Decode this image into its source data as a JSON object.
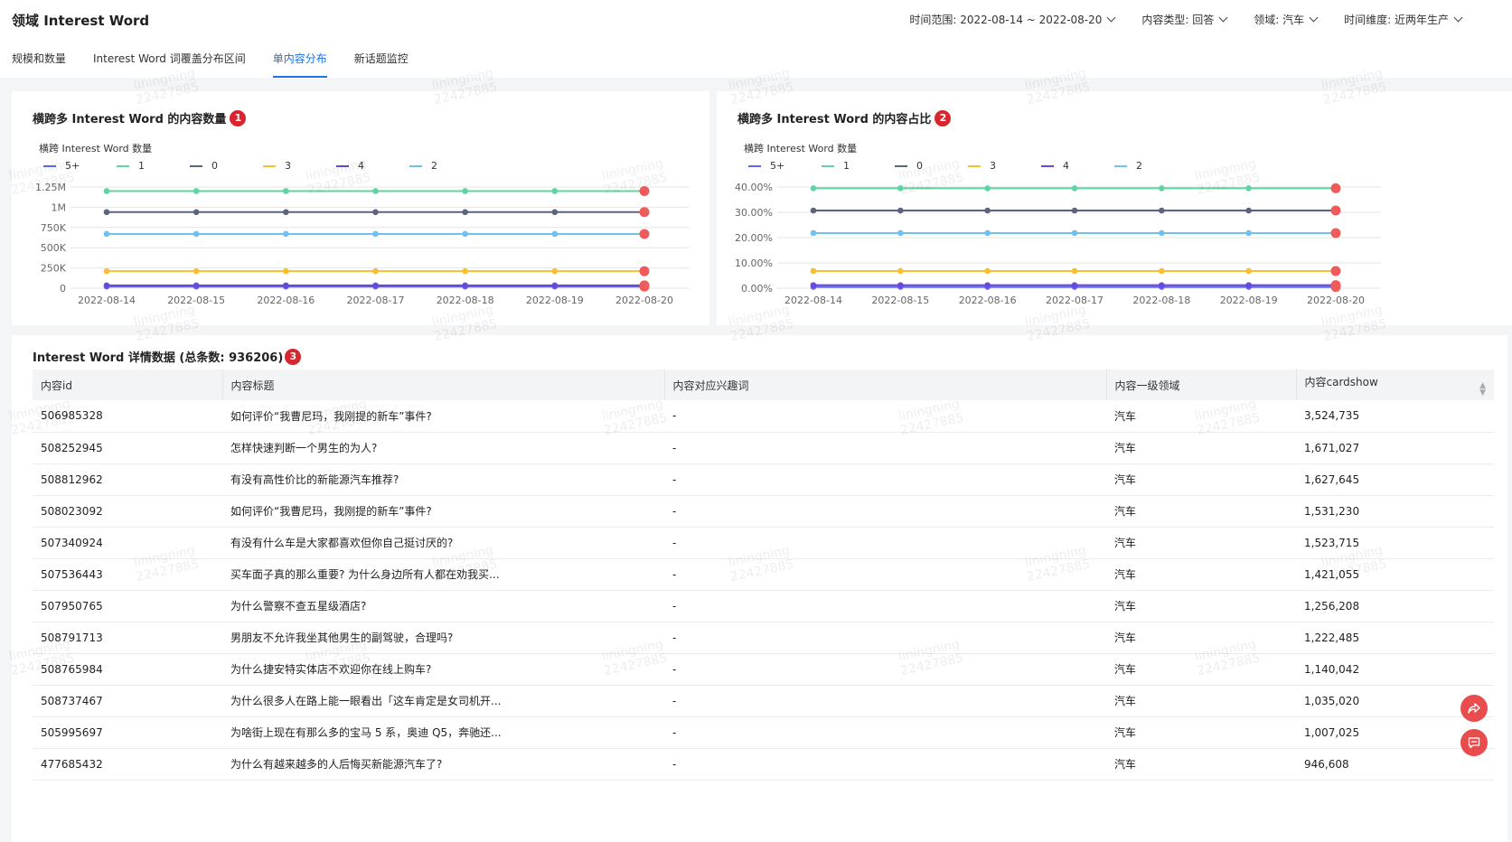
{
  "header": {
    "title": "领域 Interest Word",
    "filters": [
      {
        "label": "时间范围: 2022-08-14 ~ 2022-08-20"
      },
      {
        "label": "内容类型: 回答"
      },
      {
        "label": "领域: 汽车"
      },
      {
        "label": "时间维度: 近两年生产"
      }
    ]
  },
  "tabs": [
    {
      "label": "规模和数量",
      "active": false
    },
    {
      "label": "Interest Word 词覆盖分布区间",
      "active": false
    },
    {
      "label": "单内容分布",
      "active": true
    },
    {
      "label": "新话题监控",
      "active": false
    }
  ],
  "watermark": {
    "line1": "liningning",
    "line2": "22427885"
  },
  "panel1": {
    "title": "横跨多 Interest Word 的内容数量",
    "badge": "1",
    "legend_title": "横跨 Interest Word 数量"
  },
  "panel2": {
    "title": "横跨多 Interest Word 的内容占比",
    "badge": "2",
    "legend_title": "横跨 Interest Word 数量"
  },
  "legend": [
    {
      "name": "5+",
      "color": "#5b6af0"
    },
    {
      "name": "1",
      "color": "#5fd4a3"
    },
    {
      "name": "0",
      "color": "#5a6480"
    },
    {
      "name": "3",
      "color": "#f5c031"
    },
    {
      "name": "4",
      "color": "#6a48e0"
    },
    {
      "name": "2",
      "color": "#6fc2ee"
    }
  ],
  "chart_data": [
    {
      "type": "line",
      "x": [
        "2022-08-14",
        "2022-08-15",
        "2022-08-16",
        "2022-08-17",
        "2022-08-18",
        "2022-08-19",
        "2022-08-20"
      ],
      "yticks": [
        "0",
        "250K",
        "500K",
        "750K",
        "1M",
        "1.25M"
      ],
      "ylim": [
        0,
        1250000
      ],
      "series": [
        {
          "name": "5+",
          "values": [
            20000,
            20000,
            20000,
            20000,
            20000,
            20000,
            20000
          ]
        },
        {
          "name": "1",
          "values": [
            1200000,
            1200000,
            1200000,
            1200000,
            1200000,
            1200000,
            1200000
          ]
        },
        {
          "name": "0",
          "values": [
            940000,
            940000,
            940000,
            940000,
            940000,
            940000,
            940000
          ]
        },
        {
          "name": "3",
          "values": [
            210000,
            210000,
            210000,
            210000,
            210000,
            210000,
            210000
          ]
        },
        {
          "name": "4",
          "values": [
            35000,
            35000,
            35000,
            35000,
            35000,
            35000,
            35000
          ]
        },
        {
          "name": "2",
          "values": [
            670000,
            670000,
            670000,
            670000,
            670000,
            670000,
            670000
          ]
        }
      ],
      "grid": true,
      "legend": "top-left"
    },
    {
      "type": "line",
      "x": [
        "2022-08-14",
        "2022-08-15",
        "2022-08-16",
        "2022-08-17",
        "2022-08-18",
        "2022-08-19",
        "2022-08-20"
      ],
      "yticks": [
        "0.00%",
        "10.00%",
        "20.00%",
        "30.00%",
        "40.00%"
      ],
      "ylim": [
        0,
        40
      ],
      "series": [
        {
          "name": "5+",
          "values": [
            0.5,
            0.5,
            0.5,
            0.5,
            0.5,
            0.5,
            0.5
          ]
        },
        {
          "name": "1",
          "values": [
            39.5,
            39.5,
            39.5,
            39.5,
            39.5,
            39.5,
            39.5
          ]
        },
        {
          "name": "0",
          "values": [
            30.7,
            30.7,
            30.7,
            30.7,
            30.7,
            30.7,
            30.7
          ]
        },
        {
          "name": "3",
          "values": [
            6.8,
            6.8,
            6.8,
            6.8,
            6.8,
            6.8,
            6.8
          ]
        },
        {
          "name": "4",
          "values": [
            1.2,
            1.2,
            1.2,
            1.2,
            1.2,
            1.2,
            1.2
          ]
        },
        {
          "name": "2",
          "values": [
            21.8,
            21.8,
            21.8,
            21.8,
            21.8,
            21.8,
            21.8
          ]
        }
      ],
      "grid": true,
      "legend": "top-left"
    }
  ],
  "table": {
    "title": "Interest Word 详情数据 (总条数: 936206)",
    "badge": "3",
    "columns": [
      "内容id",
      "内容标题",
      "内容对应兴趣词",
      "内容一级领域",
      "内容cardshow"
    ],
    "rows": [
      [
        "506985328",
        "如何评价“我曹尼玛，我刚提的新车”事件?",
        "-",
        "汽车",
        "3,524,735"
      ],
      [
        "508252945",
        "怎样快速判断一个男生的为人?",
        "-",
        "汽车",
        "1,671,027"
      ],
      [
        "508812962",
        "有没有高性价比的新能源汽车推荐?",
        "-",
        "汽车",
        "1,627,645"
      ],
      [
        "508023092",
        "如何评价“我曹尼玛，我刚提的新车”事件?",
        "-",
        "汽车",
        "1,531,230"
      ],
      [
        "507340924",
        "有没有什么车是大家都喜欢但你自己挺讨厌的?",
        "-",
        "汽车",
        "1,523,715"
      ],
      [
        "507536443",
        "买车面子真的那么重要? 为什么身边所有人都在劝我买...",
        "-",
        "汽车",
        "1,421,055"
      ],
      [
        "507950765",
        "为什么警察不查五星级酒店?",
        "-",
        "汽车",
        "1,256,208"
      ],
      [
        "508791713",
        "男朋友不允许我坐其他男生的副驾驶，合理吗?",
        "-",
        "汽车",
        "1,222,485"
      ],
      [
        "508765984",
        "为什么捷安特实体店不欢迎你在线上购车?",
        "-",
        "汽车",
        "1,140,042"
      ],
      [
        "508737467",
        "为什么很多人在路上能一眼看出「这车肯定是女司机开...",
        "-",
        "汽车",
        "1,035,020"
      ],
      [
        "505995697",
        "为啥街上现在有那么多的宝马 5 系，奥迪 Q5，奔驰还...",
        "-",
        "汽车",
        "1,007,025"
      ],
      [
        "477685432",
        "为什么有越来越多的人后悔买新能源汽车了?",
        "-",
        "汽车",
        "946,608"
      ]
    ]
  }
}
